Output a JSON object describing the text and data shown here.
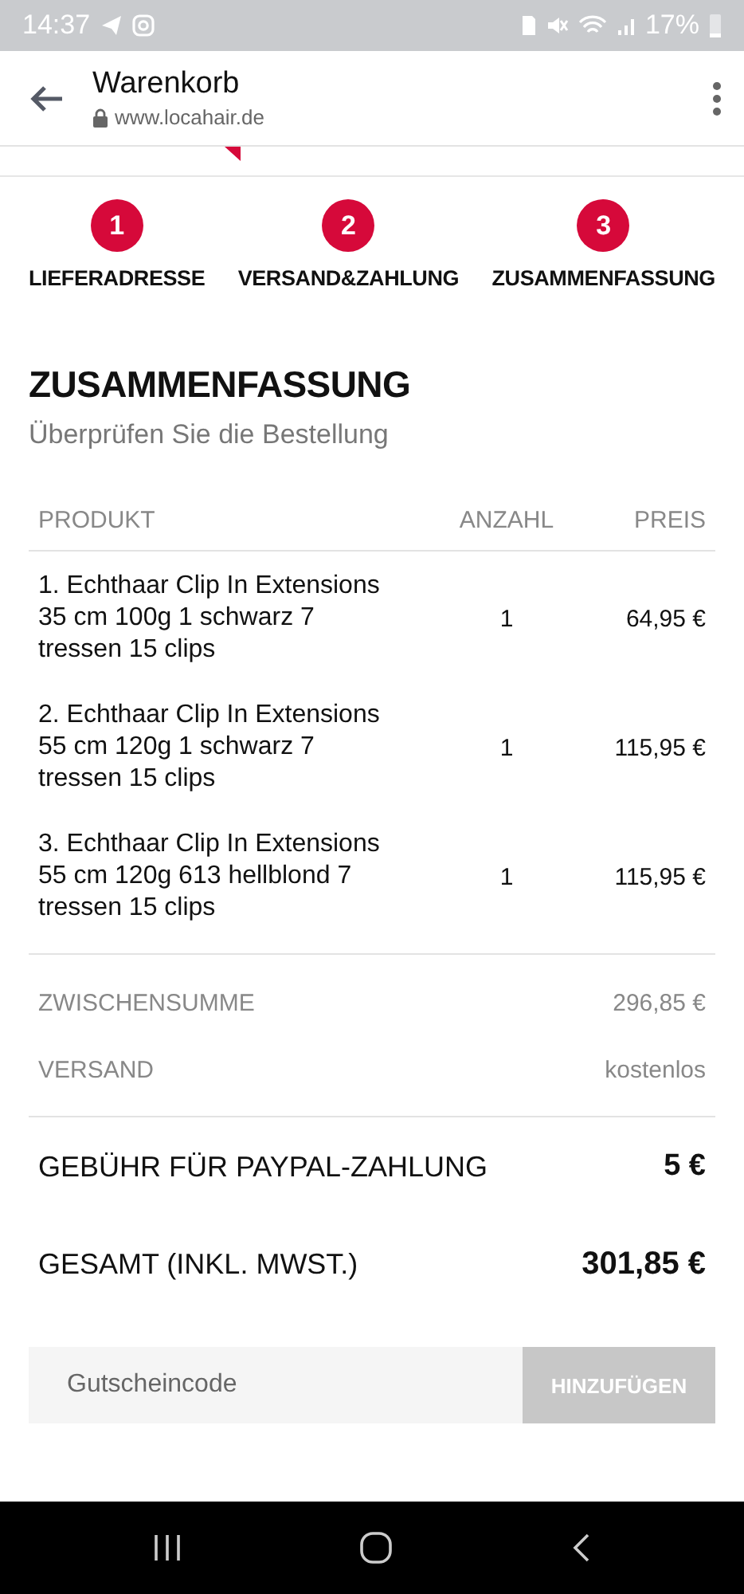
{
  "status_bar": {
    "time": "14:37",
    "battery": "17%"
  },
  "browser_header": {
    "title": "Warenkorb",
    "url": "www.locahair.de"
  },
  "steps": [
    {
      "number": "1",
      "label": "LIEFERADRESSE"
    },
    {
      "number": "2",
      "label": "VERSAND&ZAHLUNG"
    },
    {
      "number": "3",
      "label": "ZUSAMMENFASSUNG"
    }
  ],
  "summary": {
    "heading": "ZUSAMMENFASSUNG",
    "subheading": "Überprüfen Sie die Bestellung"
  },
  "table": {
    "columns": [
      "PRODUKT",
      "ANZAHL",
      "PREIS"
    ],
    "rows": [
      {
        "product": "1. Echthaar Clip In Extensions 35 cm 100g 1 schwarz 7 tressen 15 clips",
        "quantity": "1",
        "price": "64,95 €"
      },
      {
        "product": "2. Echthaar Clip In Extensions 55 cm 120g 1 schwarz 7 tressen 15 clips",
        "quantity": "1",
        "price": "115,95 €"
      },
      {
        "product": "3. Echthaar Clip In Extensions 55 cm 120g 613 hellblond 7 tressen 15 clips",
        "quantity": "1",
        "price": "115,95 €"
      }
    ]
  },
  "totals": [
    {
      "kind": "minor",
      "label": "ZWISCHENSUMME",
      "value": "296,85 €"
    },
    {
      "kind": "minor",
      "label": "VERSAND",
      "value": "kostenlos"
    },
    {
      "kind": "fee",
      "label": "GEBÜHR FÜR PAYPAL-ZAHLUNG",
      "value": "5 €"
    },
    {
      "kind": "total",
      "label": "GESAMT (INKL. MWST.)",
      "value": "301,85 €"
    }
  ],
  "coupon": {
    "placeholder": "Gutscheincode",
    "button": "HINZUFÜGEN"
  }
}
